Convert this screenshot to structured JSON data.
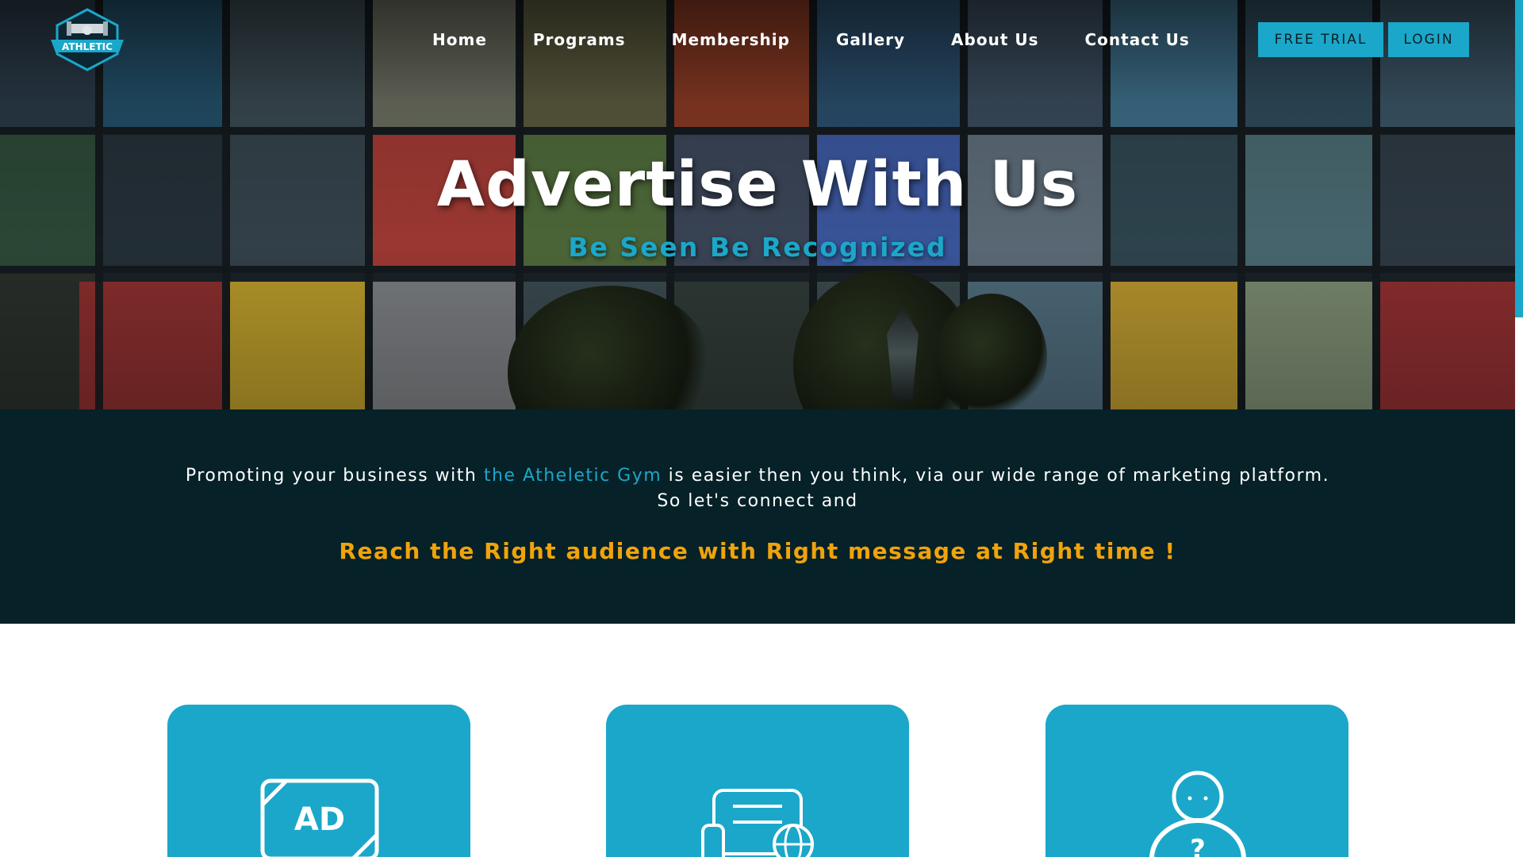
{
  "brand": {
    "logo_icon": "athletic-logo-icon",
    "logo_text": "ATHLETIC",
    "accent_color": "#1ba7c9",
    "highlight_color": "#f0a30a",
    "dark_band_color": "#062128"
  },
  "nav": {
    "items": [
      {
        "label": "Home"
      },
      {
        "label": "Programs"
      },
      {
        "label": "Membership"
      },
      {
        "label": "Gallery"
      },
      {
        "label": "About Us"
      },
      {
        "label": "Contact Us"
      }
    ],
    "free_trial_label": "FREE TRIAL",
    "login_label": "LOGIN"
  },
  "hero": {
    "title": "Advertise With Us",
    "subtitle": "Be Seen Be Recognized"
  },
  "intro": {
    "text_before": "Promoting your business with ",
    "text_highlight": "the Atheletic Gym",
    "text_after": " is easier then you think, via our wide range of marketing platform.",
    "text_line2": "So let's connect and",
    "tagline": "Reach the Right audience with Right message at Right time !"
  },
  "cards": [
    {
      "icon": "ad-icon",
      "icon_text": "AD"
    },
    {
      "icon": "online-newspaper-icon"
    },
    {
      "icon": "audience-question-icon",
      "icon_text": "?"
    }
  ]
}
